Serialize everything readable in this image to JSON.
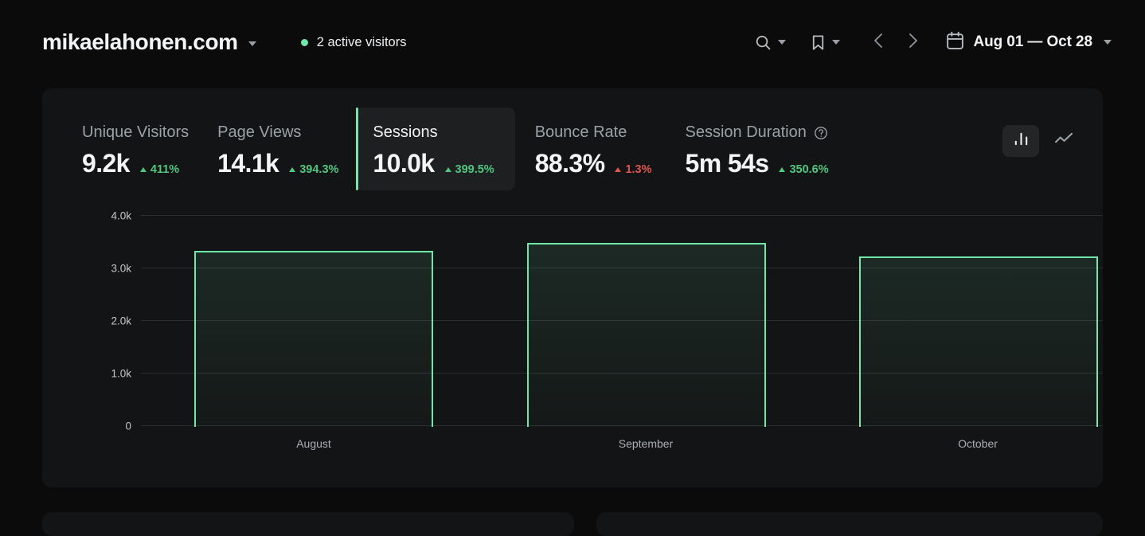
{
  "header": {
    "site_title": "mikaelahonen.com",
    "site_dropdown_icon": "chevron-down-icon",
    "active_visitors": "2 active visitors",
    "live_dot_color": "#6ee7a8",
    "search_icon": "search-icon",
    "bookmark_icon": "bookmark-icon",
    "prev_icon": "chevron-left-icon",
    "next_icon": "chevron-right-icon",
    "calendar_icon": "calendar-icon",
    "date_range": "Aug 01 — Oct 28"
  },
  "metrics": [
    {
      "label": "Unique Visitors",
      "value": "9.2k",
      "delta": "411%",
      "direction": "up",
      "delta_color": "#4ec77f",
      "selected": false,
      "has_help": false
    },
    {
      "label": "Page Views",
      "value": "14.1k",
      "delta": "394.3%",
      "direction": "up",
      "delta_color": "#4ec77f",
      "selected": false,
      "has_help": false
    },
    {
      "label": "Sessions",
      "value": "10.0k",
      "delta": "399.5%",
      "direction": "up",
      "delta_color": "#4ec77f",
      "selected": true,
      "has_help": false
    },
    {
      "label": "Bounce Rate",
      "value": "88.3%",
      "delta": "1.3%",
      "direction": "up",
      "delta_color": "#e0564f",
      "selected": false,
      "has_help": false
    },
    {
      "label": "Session Duration",
      "value": "5m 54s",
      "delta": "350.6%",
      "direction": "up",
      "delta_color": "#4ec77f",
      "selected": false,
      "has_help": true,
      "help_icon": "help-circle-icon"
    }
  ],
  "chart_toggle": {
    "bar_icon": "bar-chart-icon",
    "line_icon": "line-chart-icon",
    "active": "bar"
  },
  "chart_data": {
    "type": "bar",
    "title": "",
    "xlabel": "",
    "ylabel": "",
    "categories": [
      "August",
      "September",
      "October"
    ],
    "values": [
      3280,
      3430,
      3210
    ],
    "series": [
      {
        "name": "Sessions",
        "values": [
          3280,
          3430,
          3210
        ]
      }
    ],
    "ylim": [
      0,
      4000
    ],
    "yticks": [
      0,
      1000,
      2000,
      3000,
      4000
    ],
    "ytick_labels": [
      "0",
      "1.0k",
      "2.0k",
      "3.0k",
      "4.0k"
    ],
    "grid": true,
    "legend": "none",
    "bar_stroke": "#6ee7a8",
    "bar_fill": "rgba(110,231,168,0.09)"
  },
  "colors": {
    "page_background": "#0b0b0c",
    "panel_background": "#131415",
    "accent_green": "#6ee7a8",
    "selected_metric_background": "#1d1f20",
    "gridline": "#2b2d2f",
    "text_primary": "#f3f4f6",
    "text_muted": "#9ba1a6"
  }
}
